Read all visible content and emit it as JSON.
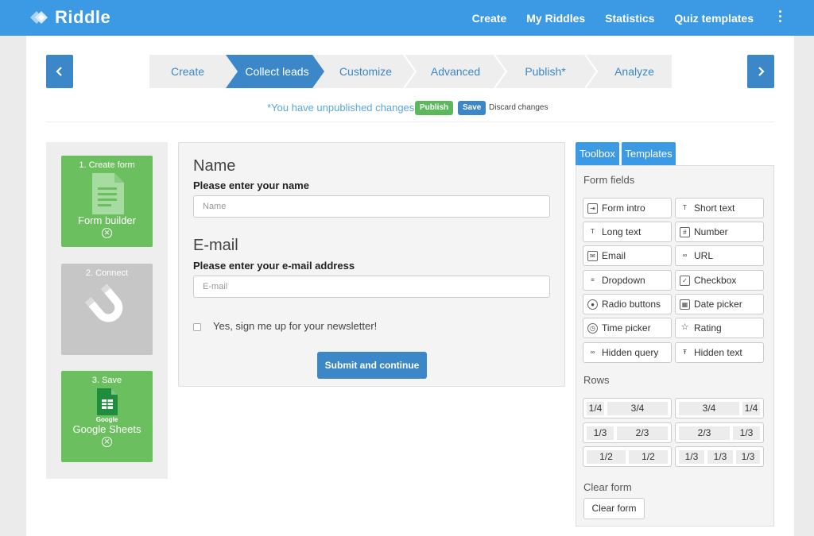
{
  "app": {
    "name": "Riddle",
    "brand_color": "#3c99e3"
  },
  "topnav": {
    "create": "Create",
    "my_riddles": "My Riddles",
    "statistics": "Statistics",
    "quiz_templates": "Quiz templates",
    "menu_icon": "kebab-menu-icon"
  },
  "steps": {
    "prev_icon": "chevron-left-icon",
    "next_icon": "chevron-right-icon",
    "items": [
      {
        "label": "Create",
        "active": false
      },
      {
        "label": "Collect leads",
        "active": true
      },
      {
        "label": "Customize",
        "active": false
      },
      {
        "label": "Advanced",
        "active": false
      },
      {
        "label": "Publish*",
        "active": false
      },
      {
        "label": "Analyze",
        "active": false
      }
    ]
  },
  "notice": {
    "message": "*You have unpublished changes",
    "separator": "-",
    "publish": "Publish",
    "save": "Save",
    "discard": "Discard changes"
  },
  "cards": [
    {
      "title": "1. Create form",
      "label": "Form builder",
      "icon": "document-icon"
    },
    {
      "title": "2. Connect",
      "label": "",
      "icon": "magnet-icon"
    },
    {
      "title": "3. Save",
      "label": "Google Sheets",
      "sublabel": "Google",
      "icon": "google-sheets-icon"
    }
  ],
  "form": {
    "name_title": "Name",
    "name_sub": "Please enter your name",
    "name_placeholder": "Name",
    "email_title": "E-mail",
    "email_sub": "Please enter your e-mail address",
    "email_placeholder": "E-mail",
    "newsletter_label": "Yes, sign me up for your newsletter!",
    "newsletter_checked": false,
    "submit_label": "Submit and continue"
  },
  "toolbox": {
    "tabs": [
      "Toolbox",
      "Templates"
    ],
    "form_fields_heading": "Form fields",
    "fields": [
      {
        "label": "Form intro",
        "icon": "form-intro-icon"
      },
      {
        "label": "Short text",
        "icon": "short-text-icon"
      },
      {
        "label": "Long text",
        "icon": "long-text-icon"
      },
      {
        "label": "Number",
        "icon": "number-icon"
      },
      {
        "label": "Email",
        "icon": "envelope-icon"
      },
      {
        "label": "URL",
        "icon": "link-icon"
      },
      {
        "label": "Dropdown",
        "icon": "dropdown-icon"
      },
      {
        "label": "Checkbox",
        "icon": "checkbox-icon"
      },
      {
        "label": "Radio buttons",
        "icon": "radio-icon"
      },
      {
        "label": "Date picker",
        "icon": "calendar-icon"
      },
      {
        "label": "Time picker",
        "icon": "clock-icon"
      },
      {
        "label": "Rating",
        "icon": "star-icon"
      },
      {
        "label": "Hidden query",
        "icon": "hidden-query-icon"
      },
      {
        "label": "Hidden text",
        "icon": "hidden-text-icon"
      }
    ],
    "rows_heading": "Rows",
    "rows": [
      [
        "1/4",
        "3/4"
      ],
      [
        "3/4",
        "1/4"
      ],
      [
        "1/3",
        "2/3"
      ],
      [
        "2/3",
        "1/3"
      ],
      [
        "1/2",
        "1/2"
      ],
      [
        "1/3",
        "1/3",
        "1/3"
      ]
    ],
    "clear_heading": "Clear form",
    "clear_label": "Clear form"
  }
}
